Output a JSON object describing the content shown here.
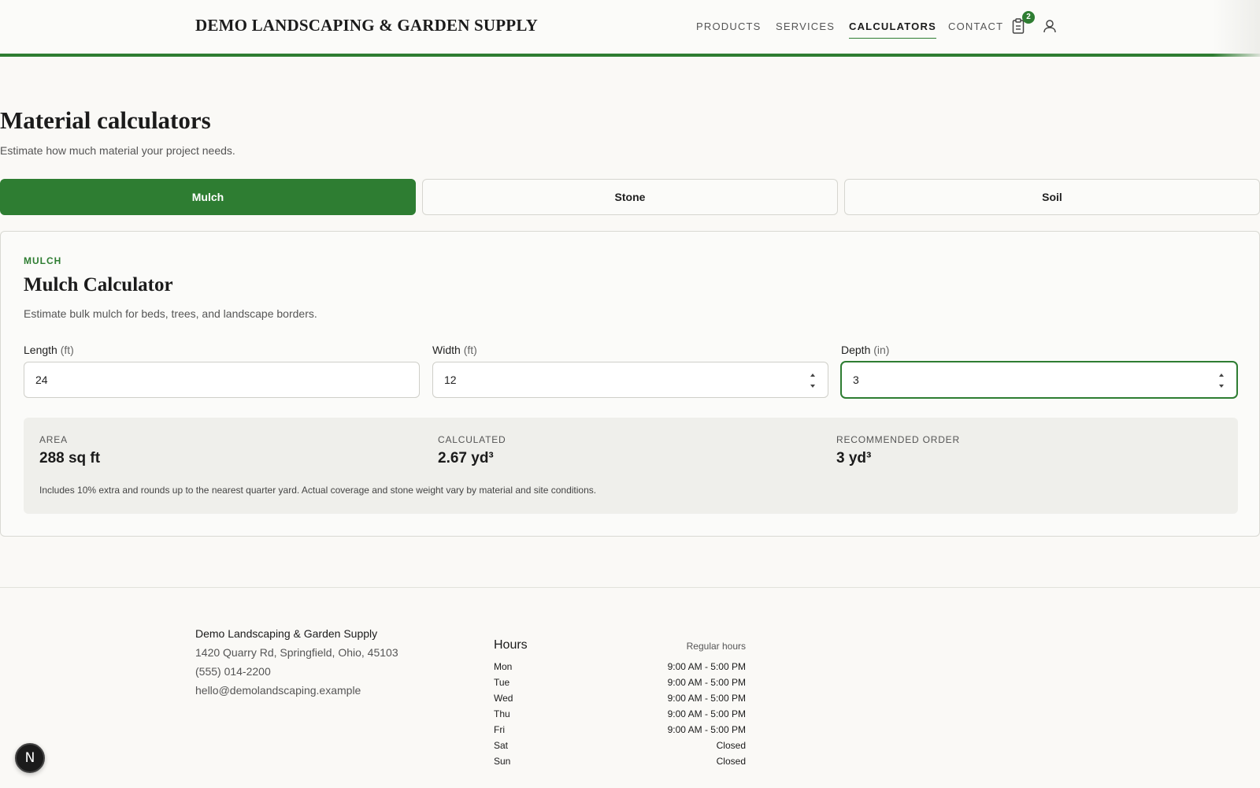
{
  "header": {
    "brand": "DEMO LANDSCAPING & GARDEN SUPPLY",
    "nav": [
      {
        "label": "PRODUCTS",
        "active": false
      },
      {
        "label": "SERVICES",
        "active": false
      },
      {
        "label": "CALCULATORS",
        "active": true
      },
      {
        "label": "CONTACT",
        "active": false
      }
    ],
    "cart_icon": "clipboard-cart-icon",
    "cart_count": "2",
    "account_icon": "user-icon"
  },
  "main": {
    "title": "Material calculators",
    "subtitle": "Estimate how much material your project needs.",
    "tabs": [
      {
        "label": "Mulch",
        "active": true
      },
      {
        "label": "Stone",
        "active": false
      },
      {
        "label": "Soil",
        "active": false
      }
    ]
  },
  "calculator": {
    "eyebrow": "MULCH",
    "title": "Mulch Calculator",
    "description": "Estimate bulk mulch for beds, trees, and landscape borders.",
    "fields": [
      {
        "label": "Length",
        "unit": "(ft)",
        "value": "24"
      },
      {
        "label": "Width",
        "unit": "(ft)",
        "value": "12"
      },
      {
        "label": "Depth",
        "unit": "(in)",
        "value": "3"
      }
    ],
    "results": [
      {
        "label": "AREA",
        "value": "288 sq ft"
      },
      {
        "label": "CALCULATED",
        "value": "2.67 yd³"
      },
      {
        "label": "RECOMMENDED ORDER",
        "value": "3 yd³"
      }
    ],
    "note": "Includes 10% extra and rounds up to the nearest quarter yard. Actual coverage and stone weight vary by material and site conditions."
  },
  "footer": {
    "name": "Demo Landscaping & Garden Supply",
    "address": "1420 Quarry Rd, Springfield, Ohio, 45103",
    "phone": "(555) 014-2200",
    "email": "hello@demolandscaping.example",
    "hours_title": "Hours",
    "hours_sub": "Regular hours",
    "hours": [
      {
        "day": "Mon",
        "time": "9:00 AM - 5:00 PM"
      },
      {
        "day": "Tue",
        "time": "9:00 AM - 5:00 PM"
      },
      {
        "day": "Wed",
        "time": "9:00 AM - 5:00 PM"
      },
      {
        "day": "Thu",
        "time": "9:00 AM - 5:00 PM"
      },
      {
        "day": "Fri",
        "time": "9:00 AM - 5:00 PM"
      },
      {
        "day": "Sat",
        "time": "Closed"
      },
      {
        "day": "Sun",
        "time": "Closed"
      }
    ]
  },
  "dev_badge": {
    "label": "N",
    "icon": "nextjs-logo-icon"
  },
  "colors": {
    "accent": "#2e7d32",
    "background": "#faf9f6",
    "panel": "#efefeb"
  }
}
